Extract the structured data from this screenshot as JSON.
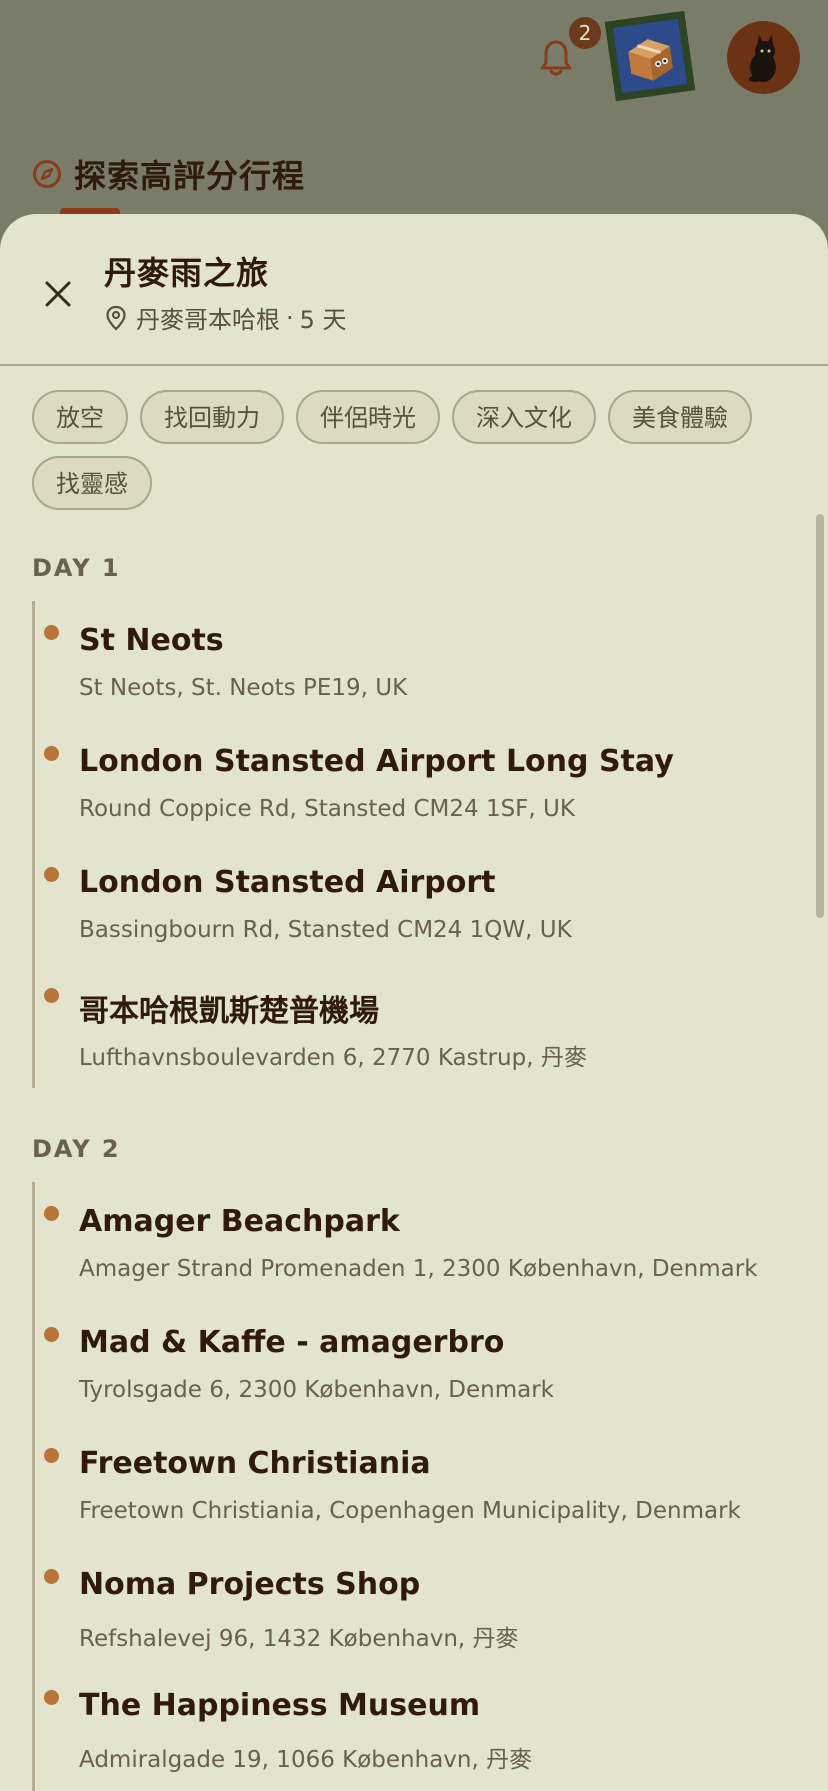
{
  "header": {
    "notification_count": "2"
  },
  "background": {
    "section_title": "探索高評分行程"
  },
  "trip": {
    "title": "丹麥雨之旅",
    "location": "丹麥哥本哈根",
    "separator": "·",
    "duration": "5 天"
  },
  "tags": [
    "放空",
    "找回動力",
    "伴侶時光",
    "深入文化",
    "美食體驗",
    "找靈感"
  ],
  "days": [
    {
      "label": "DAY 1",
      "stops": [
        {
          "name": "St Neots",
          "address": "St Neots, St. Neots PE19, UK"
        },
        {
          "name": "London Stansted Airport Long Stay",
          "address": "Round Coppice Rd, Stansted CM24 1SF, UK"
        },
        {
          "name": "London Stansted Airport",
          "address": "Bassingbourn Rd, Stansted CM24 1QW, UK"
        },
        {
          "name": "哥本哈根凱斯楚普機場",
          "address": "Lufthavnsboulevarden 6, 2770 Kastrup, 丹麥"
        }
      ]
    },
    {
      "label": "DAY 2",
      "stops": [
        {
          "name": "Amager Beachpark",
          "address": "Amager Strand Promenaden 1, 2300 København, Denmark"
        },
        {
          "name": "Mad & Kaffe - amagerbro",
          "address": "Tyrolsgade 6, 2300 København, Denmark"
        },
        {
          "name": "Freetown Christiania",
          "address": "Freetown Christiania, Copenhagen Municipality, Denmark"
        },
        {
          "name": "Noma Projects Shop",
          "address": "Refshalevej 96, 1432 København, 丹麥"
        },
        {
          "name": "The Happiness Museum",
          "address": "Admiralgade 19, 1066 København, 丹麥"
        }
      ]
    }
  ],
  "colors": {
    "accent": "#b9743a",
    "title_text": "#2f1a0c",
    "sheet_bg": "#e2e4cd",
    "overlay_bg": "#7a7c6a"
  },
  "icons": {
    "notification": "bell-icon",
    "explore": "compass-icon",
    "close": "close-icon",
    "location": "map-pin-icon"
  }
}
